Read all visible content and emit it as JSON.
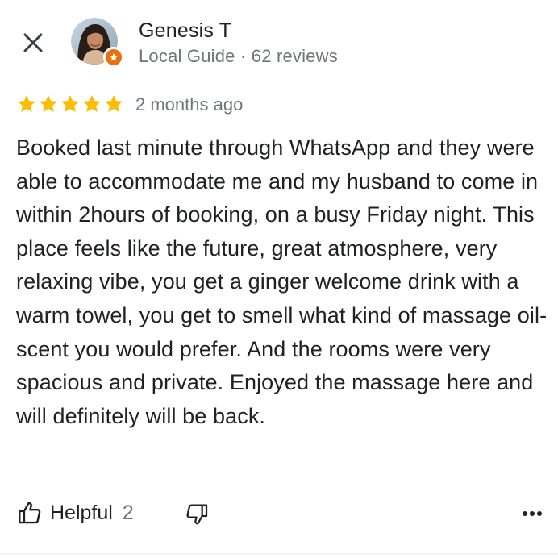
{
  "header": {
    "close_icon": "close-icon",
    "reviewer_name": "Genesis T",
    "reviewer_meta": "Local Guide · 62 reviews",
    "badge_icon": "local-guide-star-icon",
    "badge_color": "#e8710a"
  },
  "rating": {
    "stars": 5,
    "max_stars": 5,
    "star_color": "#fbbc04",
    "date": "2 months ago"
  },
  "review": {
    "text": "Booked last minute through WhatsApp and they were able to accommodate me and my husband to come in within 2hours of booking, on a busy Friday night. This place feels like the future, great atmosphere, very relaxing vibe, you get a ginger welcome drink with a warm towel, you get to smell what kind of massage oil-scent you would prefer. And the rooms were very spacious and private. Enjoyed the massage here and will definitely will be back."
  },
  "actions": {
    "helpful_label": "Helpful",
    "helpful_count": "2",
    "like_icon": "thumbs-up-icon",
    "dislike_icon": "thumbs-down-icon",
    "more_icon": "more-options-icon"
  }
}
